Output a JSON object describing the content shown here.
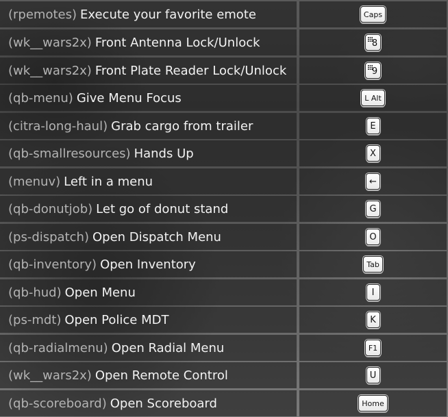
{
  "keybinds": [
    {
      "resource": "(rpemotes)",
      "action": "Execute your favorite emote",
      "key": "Caps",
      "key_icon": "keycap-caps"
    },
    {
      "resource": "(wk__wars2x)",
      "action": "Front Antenna Lock/Unlock",
      "key": "8",
      "key_icon": "numpad-8"
    },
    {
      "resource": "(wk__wars2x)",
      "action": "Front Plate Reader Lock/Unlock",
      "key": "9",
      "key_icon": "numpad-9"
    },
    {
      "resource": "(qb-menu)",
      "action": "Give Menu Focus",
      "key": "L Alt",
      "key_icon": "keycap-lalt"
    },
    {
      "resource": "(citra-long-haul)",
      "action": "Grab cargo from trailer",
      "key": "E",
      "key_icon": "keycap-e"
    },
    {
      "resource": "(qb-smallresources)",
      "action": "Hands Up",
      "key": "X",
      "key_icon": "keycap-x"
    },
    {
      "resource": "(menuv)",
      "action": "Left in a menu",
      "key": "←",
      "key_icon": "arrow-left"
    },
    {
      "resource": "(qb-donutjob)",
      "action": "Let go of donut stand",
      "key": "G",
      "key_icon": "keycap-g"
    },
    {
      "resource": "(ps-dispatch)",
      "action": "Open Dispatch Menu",
      "key": "O",
      "key_icon": "keycap-o"
    },
    {
      "resource": "(qb-inventory)",
      "action": "Open Inventory",
      "key": "Tab",
      "key_icon": "keycap-tab"
    },
    {
      "resource": "(qb-hud)",
      "action": "Open Menu",
      "key": "I",
      "key_icon": "keycap-i"
    },
    {
      "resource": "(ps-mdt)",
      "action": "Open Police MDT",
      "key": "K",
      "key_icon": "keycap-k"
    },
    {
      "resource": "(qb-radialmenu)",
      "action": "Open Radial Menu",
      "key": "F1",
      "key_icon": "keycap-f1"
    },
    {
      "resource": "(wk__wars2x)",
      "action": "Open Remote Control",
      "key": "U",
      "key_icon": "keycap-u"
    },
    {
      "resource": "(qb-scoreboard)",
      "action": "Open Scoreboard",
      "key": "Home",
      "key_icon": "keycap-home"
    }
  ],
  "colors": {
    "resource_text": "#b4b4b4",
    "action_text": "#f2f2f2",
    "cell_background": "rgba(28,28,28,0.62)",
    "keycap_background": "#ffffff",
    "keycap_text": "#111111"
  }
}
